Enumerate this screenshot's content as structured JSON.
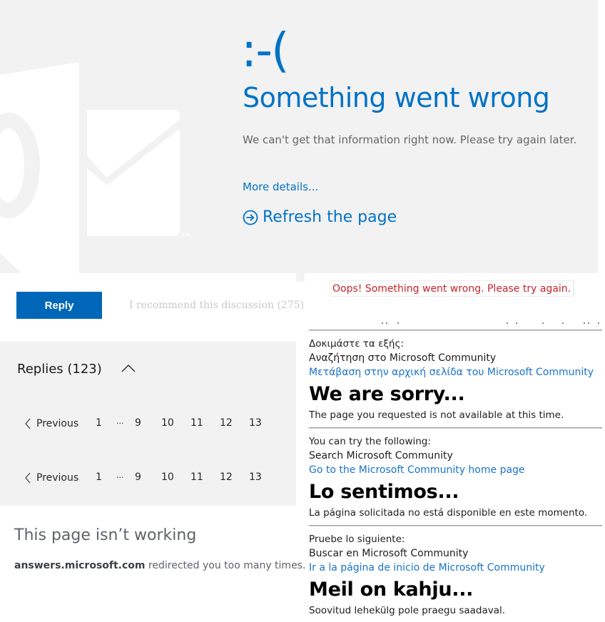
{
  "outlook_error": {
    "sad_face": ":-(",
    "title": "Something went wrong",
    "message": "We can't get that information right now. Please try again later.",
    "more_details_link": "More details...",
    "refresh_link": "Refresh the page",
    "refresh_icon": "circle-arrow-right-icon",
    "logo": "outlook-logo",
    "trademark": "TM",
    "colors": {
      "accent": "#0072c6",
      "panel_bg": "#f2f2f2",
      "body_text": "#666666"
    }
  },
  "discussion": {
    "reply_button": "Reply",
    "recommend_link": "I recommend this discussion (275)",
    "colors": {
      "reply_button_bg": "#0067b8"
    }
  },
  "replies": {
    "title": "Replies (123)",
    "collapse_icon": "chevron-up-icon",
    "pagination": [
      {
        "previous_label": "Previous",
        "pages": [
          "1",
          "...",
          "9",
          "10",
          "11",
          "12",
          "13"
        ]
      },
      {
        "previous_label": "Previous",
        "pages": [
          "1",
          "...",
          "9",
          "10",
          "11",
          "12",
          "13"
        ]
      }
    ]
  },
  "browser_error": {
    "title": "This page isn’t working",
    "domain": "answers.microsoft.com",
    "message": " redirected you too many times."
  },
  "community_error": {
    "oops_message": "Oops! Something went wrong. Please try again.",
    "oops_color": "#c5242b",
    "greek": {
      "try_label": "Δοκιμάστε τα εξής:",
      "search_text": "Αναζήτηση στο Microsoft Community",
      "home_link": "Μετάβαση στην αρχική σελίδα του Microsoft Community"
    },
    "english": {
      "heading": "We are sorry...",
      "unavailable": "The page you requested is not available at this time.",
      "try_label": "You can try the following:",
      "search_text": "Search Microsoft Community",
      "home_link": "Go to the Microsoft Community home page"
    },
    "spanish": {
      "heading": "Lo sentimos...",
      "unavailable": "La página solicitada no está disponible en este momento.",
      "try_label": "Pruebe lo siguiente:",
      "search_text": "Buscar en Microsoft Community",
      "home_link": "Ir a la página de inicio de Microsoft Community"
    },
    "estonian": {
      "heading": "Meil on kahju...",
      "unavailable": "Soovitud lehekülg pole praegu saadaval."
    }
  }
}
